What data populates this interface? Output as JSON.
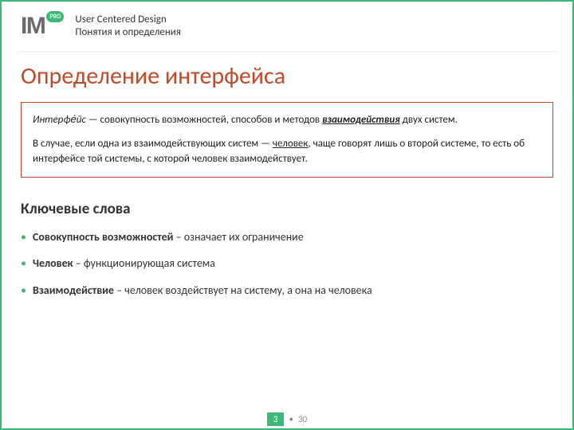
{
  "logo": {
    "main": "IM",
    "badge": "PRO"
  },
  "header": {
    "title": "User Centered Design",
    "subtitle": "Понятия и определения"
  },
  "title": "Определение интерфейса",
  "definition": {
    "term": "Интерфе́йс",
    "sep": " — совокупность возможностей, способов и методов ",
    "emph": "взаимодействия",
    "tail": " двух систем.",
    "p2a": "В случае, если одна из взаимодействующих систем — ",
    "p2u": "человек",
    "p2b": ", чаще говорят лишь о второй системе, то есть об интерфейсе той системы, с которой человек взаимодействует."
  },
  "subhead": "Ключевые слова",
  "bullets": [
    {
      "strong": "Совокупность возможностей",
      "rest": " – означает их ограничение"
    },
    {
      "strong": "Человек",
      "rest": " – функционирующая система"
    },
    {
      "strong": "Взаимодействие",
      "rest": " – человек воздействует на систему, а она на человека"
    }
  ],
  "pager": {
    "current": "3",
    "sep": "•",
    "total": "30",
    "bullet": "•"
  }
}
